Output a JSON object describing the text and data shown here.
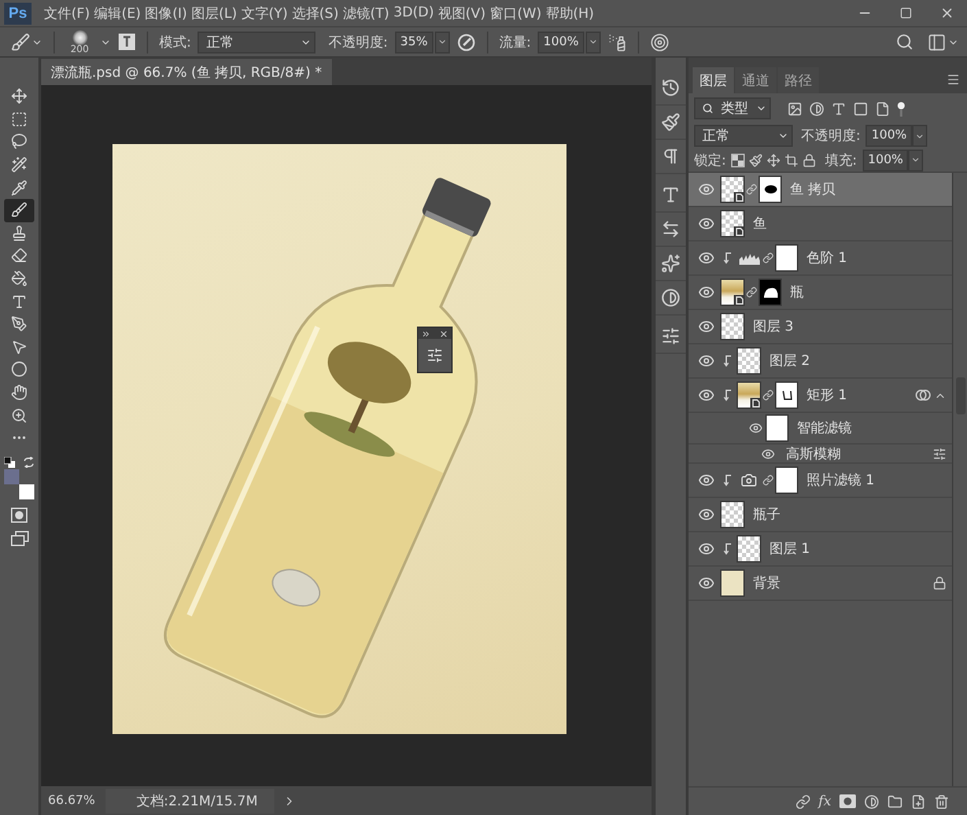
{
  "app": {
    "logo": "Ps"
  },
  "menu": [
    "文件(F)",
    "编辑(E)",
    "图像(I)",
    "图层(L)",
    "文字(Y)",
    "选择(S)",
    "滤镜(T)",
    "3D(D)",
    "视图(V)",
    "窗口(W)",
    "帮助(H)"
  ],
  "options_bar": {
    "brush_size": "200",
    "mode_label": "模式:",
    "mode": "正常",
    "opacity_label": "不透明度:",
    "opacity": "35%",
    "flow_label": "流量:",
    "flow": "100%"
  },
  "tools": [
    {
      "kind": "move",
      "selected": false
    },
    {
      "kind": "marquee",
      "selected": false
    },
    {
      "kind": "lasso",
      "selected": false
    },
    {
      "kind": "wand",
      "selected": false
    },
    {
      "kind": "eyedropper",
      "selected": false
    },
    {
      "kind": "brush",
      "selected": true
    },
    {
      "kind": "stamp",
      "selected": false
    },
    {
      "kind": "eraser",
      "selected": false
    },
    {
      "kind": "bucket",
      "selected": false
    },
    {
      "kind": "type",
      "selected": false
    },
    {
      "kind": "pen",
      "selected": false
    },
    {
      "kind": "select",
      "selected": false
    },
    {
      "kind": "ellipse",
      "selected": false
    },
    {
      "kind": "hand",
      "selected": false
    },
    {
      "kind": "zoom",
      "selected": false
    },
    {
      "kind": "more",
      "selected": false
    }
  ],
  "swatches": [
    {
      "kind": "foreground",
      "color": "#6b6f8e"
    },
    {
      "kind": "background",
      "color": "#ffffff"
    }
  ],
  "document": {
    "tab": "漂流瓶.psd @ 66.7% (鱼 拷贝, RGB/8#) *"
  },
  "status_bar": {
    "zoom": "66.67%",
    "doc_info": "文档:2.21M/15.7M"
  },
  "layers_panel": {
    "tabs": [
      {
        "label": "图层",
        "selected": true
      },
      {
        "label": "通道",
        "selected": false
      },
      {
        "label": "路径",
        "selected": false
      }
    ],
    "filter": "类型",
    "blend_mode": "正常",
    "opacity_label": "不透明度:",
    "opacity": "100%",
    "lock_label": "锁定:",
    "fill_label": "填充:",
    "fill": "100%",
    "layers": [
      {
        "name": "鱼 拷贝",
        "kind": "pixel",
        "thumb": {
          "kind": "transparent",
          "smart": true
        },
        "mask": {
          "kind": "blob"
        },
        "clipped": false,
        "visible": true,
        "selected": true,
        "locked": false
      },
      {
        "name": "鱼",
        "kind": "pixel",
        "thumb": {
          "kind": "transparent",
          "smart": true
        },
        "clipped": false,
        "visible": true,
        "selected": false,
        "locked": false
      },
      {
        "name": "色阶 1",
        "kind": "levels",
        "mask": {
          "kind": "white"
        },
        "clipped": true,
        "visible": true,
        "selected": false,
        "locked": false
      },
      {
        "name": "瓶",
        "kind": "pixel",
        "thumb": {
          "kind": "image",
          "smart": true
        },
        "mask": {
          "kind": "inverse"
        },
        "clipped": false,
        "visible": true,
        "selected": false,
        "locked": false
      },
      {
        "name": "图层 3",
        "kind": "pixel",
        "thumb": {
          "kind": "transparent",
          "smart": false
        },
        "clipped": false,
        "visible": true,
        "selected": false,
        "locked": false
      },
      {
        "name": "图层 2",
        "kind": "pixel",
        "thumb": {
          "kind": "transparent",
          "smart": false
        },
        "clipped": true,
        "visible": true,
        "selected": false,
        "locked": false
      },
      {
        "name": "矩形 1",
        "kind": "pixel",
        "thumb": {
          "kind": "image",
          "smart": true
        },
        "mask": {
          "kind": "stroke"
        },
        "clipped": true,
        "visible": true,
        "selected": false,
        "locked": false,
        "expanded": true,
        "children": [
          {
            "name": "智能滤镜",
            "kind": "smart-filters",
            "mask": {
              "kind": "white"
            },
            "visible": true,
            "selected": false,
            "children": [
              {
                "name": "高斯模糊",
                "kind": "filter",
                "visible": true,
                "selected": false
              }
            ]
          }
        ]
      },
      {
        "name": "照片滤镜 1",
        "kind": "photo-filter",
        "mask": {
          "kind": "white"
        },
        "clipped": true,
        "visible": true,
        "selected": false,
        "locked": false
      },
      {
        "name": "瓶子",
        "kind": "pixel",
        "thumb": {
          "kind": "transparent",
          "smart": false
        },
        "clipped": false,
        "visible": true,
        "selected": false,
        "locked": false
      },
      {
        "name": "图层 1",
        "kind": "pixel",
        "thumb": {
          "kind": "transparent",
          "smart": false
        },
        "clipped": true,
        "visible": true,
        "selected": false,
        "locked": false
      },
      {
        "name": "背景",
        "kind": "pixel",
        "thumb": {
          "kind": "solid",
          "smart": false
        },
        "clipped": false,
        "visible": true,
        "selected": false,
        "locked": true
      }
    ],
    "style_button": "fx"
  }
}
